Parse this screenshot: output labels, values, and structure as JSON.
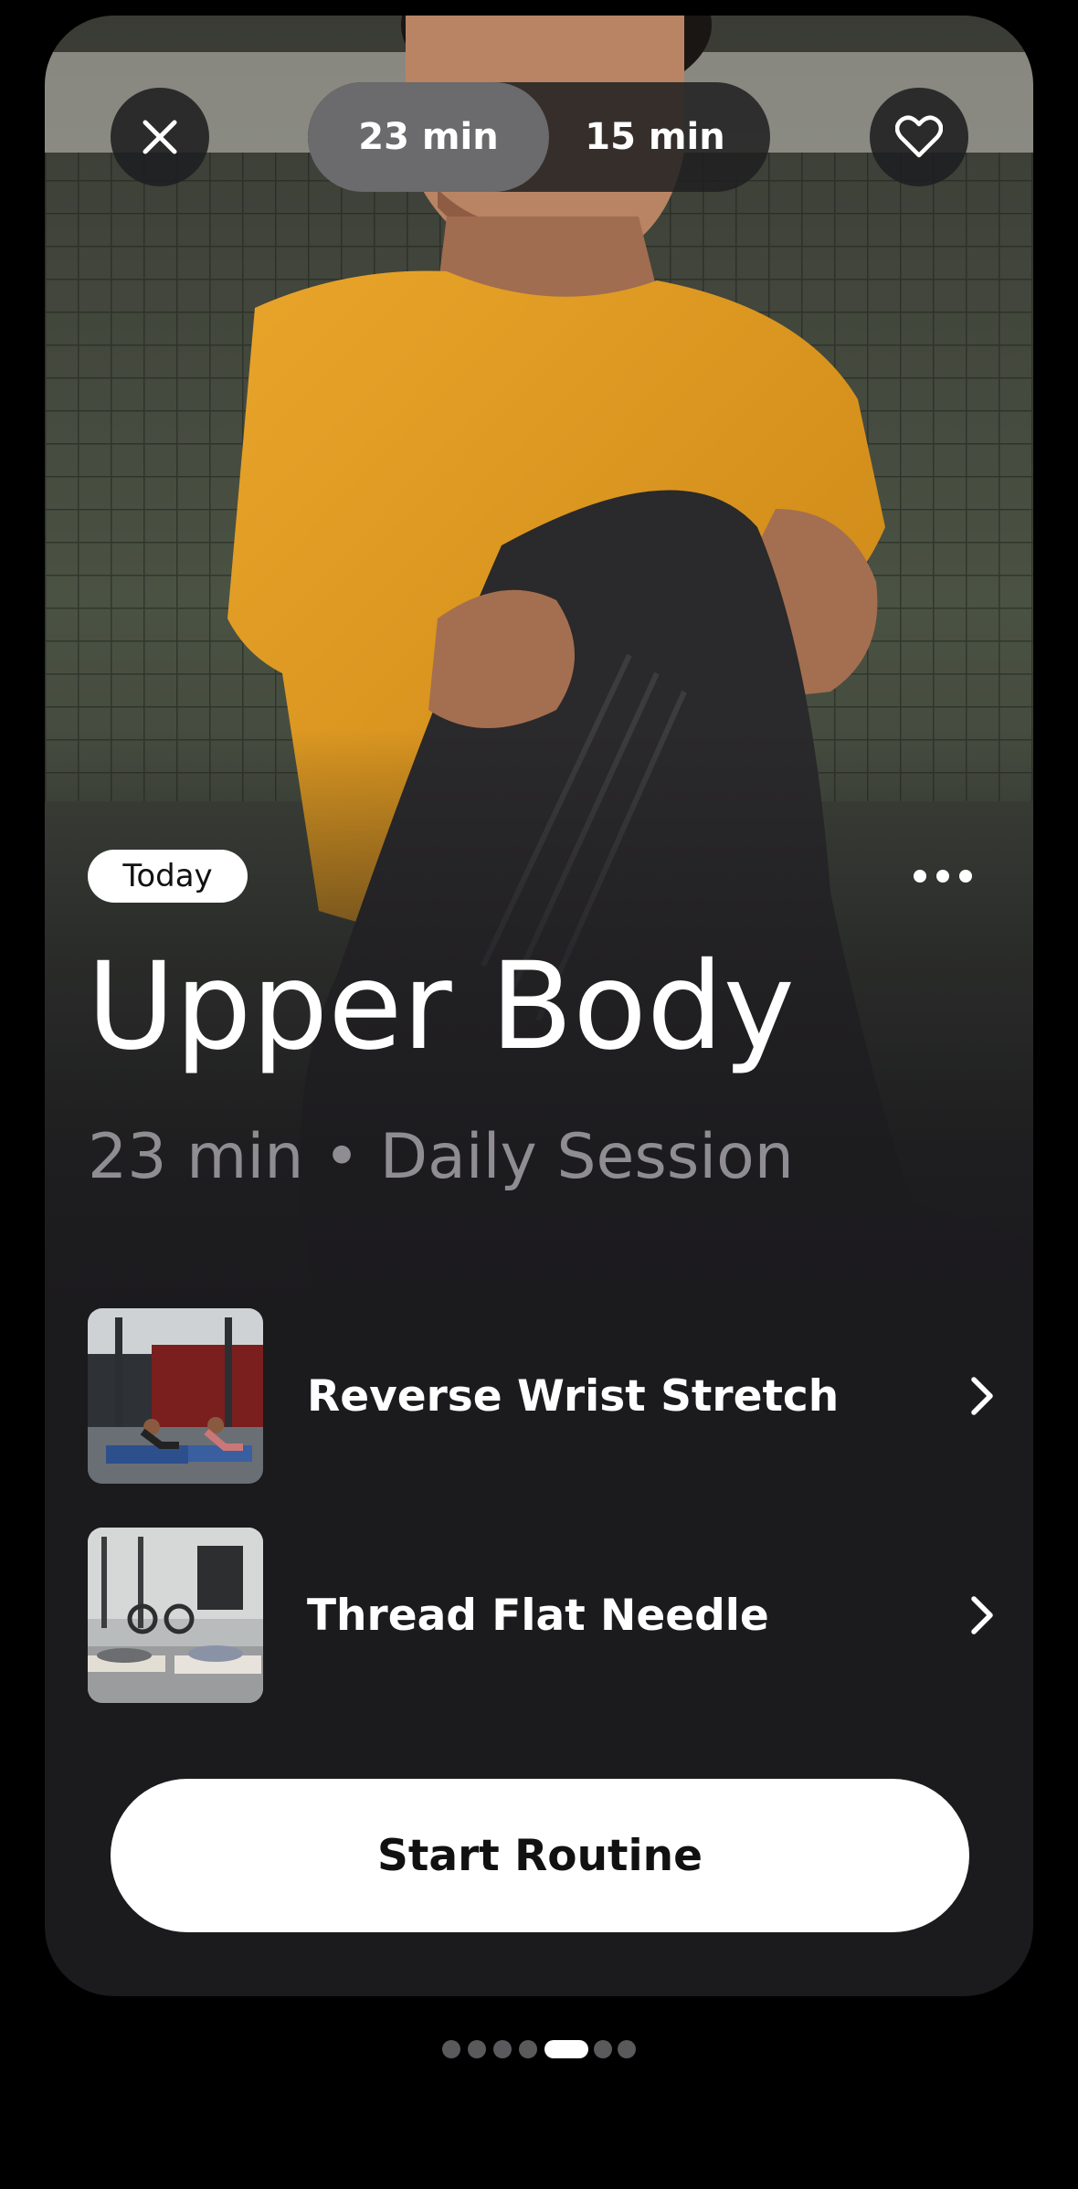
{
  "header": {
    "close_icon": "close-icon",
    "favorite_icon": "heart-icon",
    "duration_options": [
      "23 min",
      "15 min"
    ],
    "selected_duration": "23 min"
  },
  "workout": {
    "badge": "Today",
    "more_icon": "more-horizontal-icon",
    "title": "Upper Body",
    "subtitle": "23 min • Daily Session"
  },
  "exercises": [
    {
      "name": "Reverse Wrist Stretch",
      "icon": "chevron-right-icon"
    },
    {
      "name": "Thread Flat Needle",
      "icon": "chevron-right-icon"
    }
  ],
  "cta": {
    "label": "Start Routine"
  },
  "pager": {
    "count": 7,
    "active_index": 4
  },
  "colors": {
    "background": "#000000",
    "card": "#1b1a1d",
    "shirt": "#e7a025",
    "button": "#ffffff",
    "muted_text": "#8f8d92"
  }
}
